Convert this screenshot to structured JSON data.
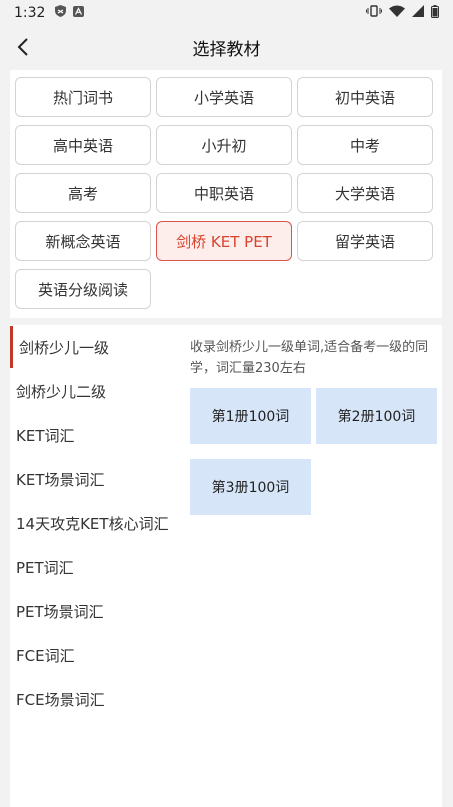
{
  "status_bar": {
    "time": "1:32"
  },
  "header": {
    "title": "选择教材"
  },
  "categories": [
    {
      "label": "热门词书",
      "active": false
    },
    {
      "label": "小学英语",
      "active": false
    },
    {
      "label": "初中英语",
      "active": false
    },
    {
      "label": "高中英语",
      "active": false
    },
    {
      "label": "小升初",
      "active": false
    },
    {
      "label": "中考",
      "active": false
    },
    {
      "label": "高考",
      "active": false
    },
    {
      "label": "中职英语",
      "active": false
    },
    {
      "label": "大学英语",
      "active": false
    },
    {
      "label": "新概念英语",
      "active": false
    },
    {
      "label": "剑桥 KET PET",
      "active": true
    },
    {
      "label": "留学英语",
      "active": false
    },
    {
      "label": "英语分级阅读",
      "active": false
    }
  ],
  "sidebar": {
    "items": [
      {
        "label": "剑桥少儿一级",
        "active": true
      },
      {
        "label": "剑桥少儿二级",
        "active": false
      },
      {
        "label": "KET词汇",
        "active": false
      },
      {
        "label": "KET场景词汇",
        "active": false
      },
      {
        "label": "14天攻克KET核心词汇",
        "active": false
      },
      {
        "label": "PET词汇",
        "active": false
      },
      {
        "label": "PET场景词汇",
        "active": false
      },
      {
        "label": "FCE词汇",
        "active": false
      },
      {
        "label": "FCE场景词汇",
        "active": false
      }
    ]
  },
  "content": {
    "description": "收录剑桥少儿一级单词,适合备考一级的同学，词汇量230左右",
    "books": [
      "第1册100词",
      "第2册100词",
      "第3册100词"
    ]
  },
  "colors": {
    "accent": "#d9422f",
    "active_bg": "#fdeeeb",
    "book_bg": "#d6e6f8",
    "page_bg": "#f2f2f2"
  }
}
